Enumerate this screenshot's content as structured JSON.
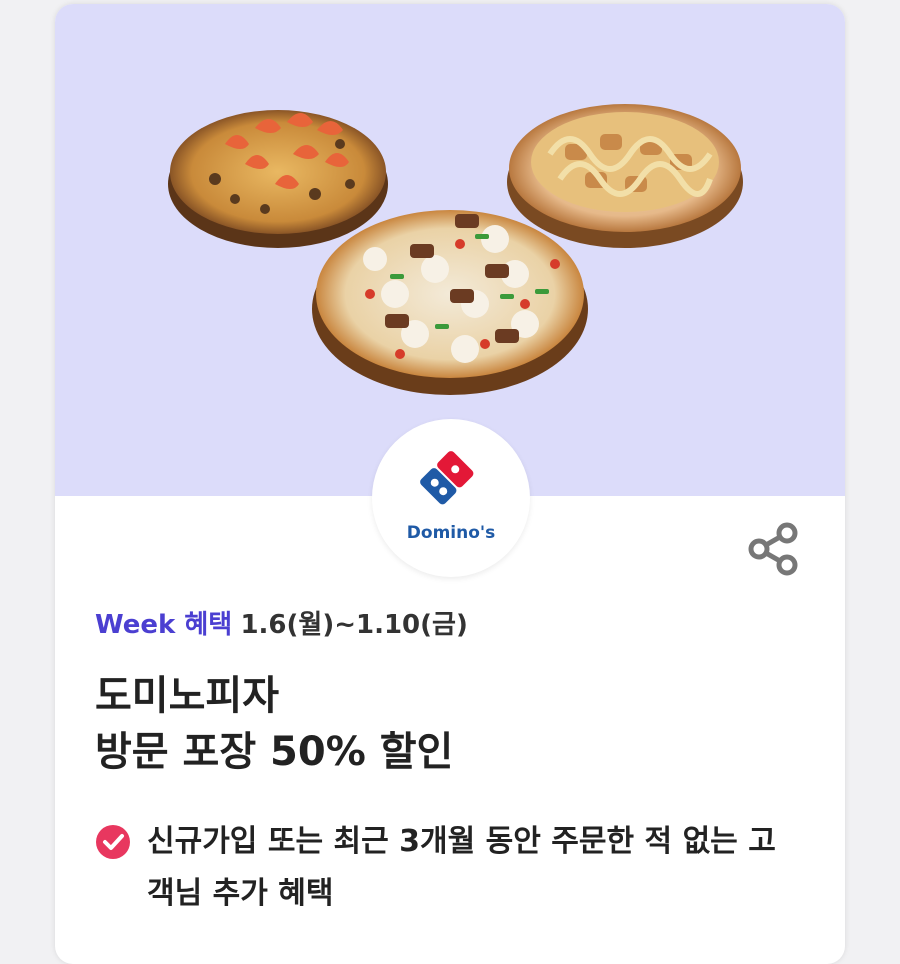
{
  "promo": {
    "brand_logo_text": "Domino's",
    "week_label": "Week 혜택",
    "date_range": "1.6(월)~1.10(금)",
    "title_line1": "도미노피자",
    "title_line2": "방문 포장 50% 할인",
    "benefit_text": "신규가입 또는 최근 3개월 동안 주문한 적 없는 고객님 추가 혜택"
  },
  "colors": {
    "hero_bg": "#dcdcfa",
    "accent": "#4b3fd1",
    "check": "#e8375f"
  },
  "icons": {
    "share": "share-icon",
    "check": "check-circle-icon"
  }
}
